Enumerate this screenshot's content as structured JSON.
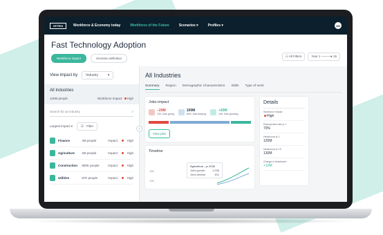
{
  "nav": {
    "logo": "VETRIX",
    "links": [
      "Workforce & Economy today",
      "Workforce of the Future",
      "Scenarios ▾",
      "Profiles ▾"
    ],
    "active_index": 1,
    "user_initials": "AN"
  },
  "header": {
    "title": "Fast Technology Adoption",
    "tabs": [
      "Workforce impact",
      "Scenario definition"
    ],
    "all_filters": "All Filters",
    "year_label": "Year",
    "year_start": "1",
    "year_end": "15"
  },
  "left": {
    "view_by_label": "View impact by",
    "view_by_value": "Industry",
    "all_industries": {
      "title": "All Industries",
      "people": "120M people",
      "impact_label": "Workforce Impact:",
      "impact_value": "High"
    },
    "search_placeholder": "Search for an industry",
    "sort_value": "Largest impact",
    "filter_label": "Filter",
    "industries": [
      {
        "name": "Finance",
        "people": "4M people",
        "impact_label": "Impact:",
        "impact": "High"
      },
      {
        "name": "Agriculture",
        "people": "2M people",
        "impact_label": "Impact:",
        "impact": "High"
      },
      {
        "name": "Construction",
        "people": "590K people",
        "impact_label": "Impact:",
        "impact": "High"
      },
      {
        "name": "Utilities",
        "people": "87K people",
        "impact_label": "Impact:",
        "impact": "High"
      }
    ]
  },
  "main": {
    "title": "All Industries",
    "tabs": [
      "Summary",
      "Region",
      "Demographic Characteristics",
      "Skills",
      "Type of work"
    ],
    "jobs_impact": {
      "title": "Jobs impact",
      "stats": [
        {
          "value": "−20M",
          "label": "13K Jobs going",
          "color": "#e0483e"
        },
        {
          "value": "100M",
          "label": "60% Jobs staying",
          "color": "#7fa9d6"
        },
        {
          "value": "+20M",
          "label": "10K Jobs growing",
          "color": "#3bb79d"
        }
      ],
      "bar_shares": [
        0.2,
        0.6,
        0.2
      ],
      "view_jobs": "View jobs"
    },
    "timeline": {
      "title": "Timeline",
      "y_labels": [
        "15K",
        "10K"
      ],
      "tooltip_title": "Agriculture - yr 2030",
      "tooltip_lines": [
        {
          "label": "Jobs growth",
          "value": "1,938"
        },
        {
          "label": "Jobs decline",
          "value": "811"
        }
      ]
    },
    "details": {
      "title": "Details",
      "items": [
        {
          "label": "Workforce Impact",
          "value": "High"
        },
        {
          "label": "Employment rate yr 1",
          "value": "70%"
        },
        {
          "label": "Headcount yr 1",
          "value": "120M"
        },
        {
          "label": "Headcount yr 15",
          "value": "130M"
        },
        {
          "label": "Change in headcount",
          "value": "+10M"
        }
      ]
    }
  }
}
